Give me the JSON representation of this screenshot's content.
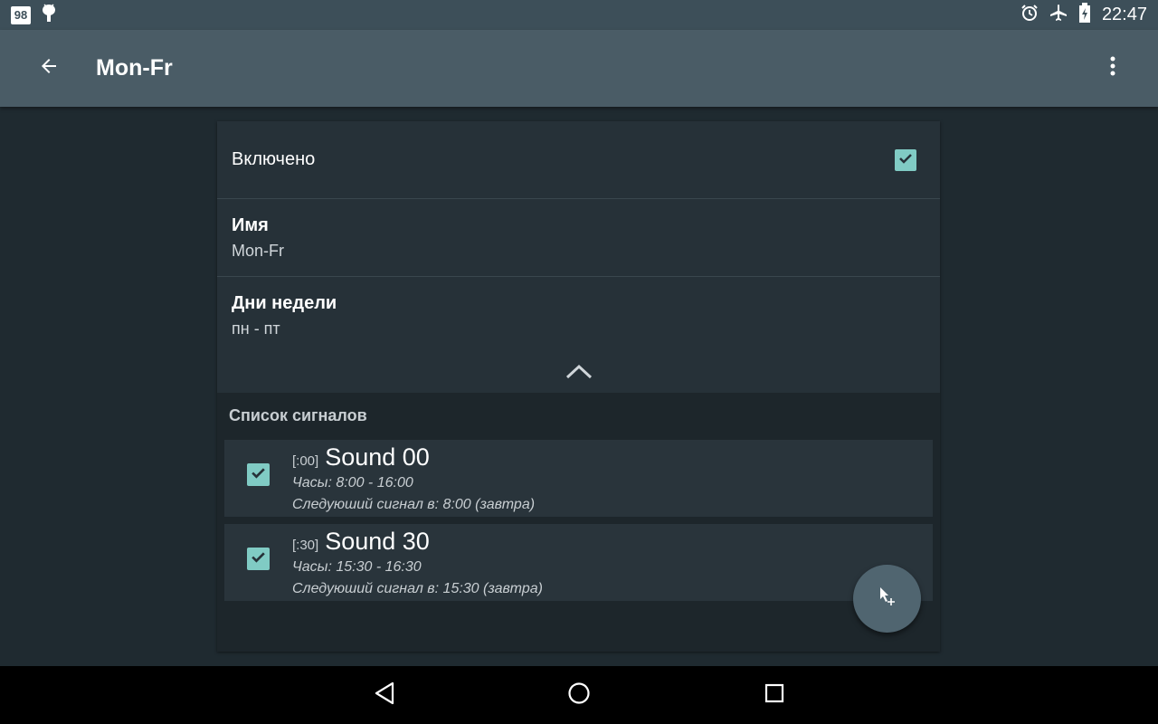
{
  "status_bar": {
    "notification_badge": "98",
    "time": "22:47",
    "icons": [
      "alarm-icon",
      "airplane-icon",
      "battery-charging-icon"
    ]
  },
  "app_bar": {
    "title": "Mon-Fr"
  },
  "settings": {
    "enabled_label": "Включено",
    "enabled_checked": true,
    "name_label": "Имя",
    "name_value": "Mon-Fr",
    "days_label": "Дни недели",
    "days_value": "пн - пт"
  },
  "signals_section": {
    "header": "Список сигналов",
    "items": [
      {
        "code": "[:00]",
        "name": "Sound 00",
        "hours": "Часы: 8:00 - 16:00",
        "next": "Следуюший сигнал в: 8:00 (завтра)",
        "checked": true
      },
      {
        "code": "[:30]",
        "name": "Sound 30",
        "hours": "Часы: 15:30 - 16:30",
        "next": "Следуюший сигнал в: 15:30 (завтра)",
        "checked": true
      }
    ]
  },
  "colors": {
    "accent": "#80cbc4",
    "app_bar": "#4a5c66",
    "status_bar": "#3d4f59",
    "background": "#1f2a30"
  }
}
